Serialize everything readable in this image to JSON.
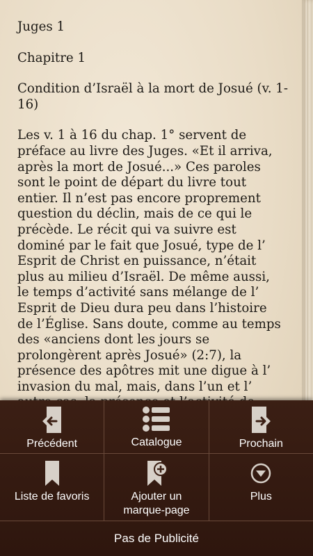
{
  "reader": {
    "book_title": "Juges 1",
    "chapter_title": "Chapitre 1",
    "section_title": "Condition d’Israël à la mort de Josué (v. 1-16)",
    "body_lines": [
      "Les v. 1 à 16 du chap. 1° servent de",
      "préface au livre des Juges. «Et il arriva,",
      "après la mort de Josué...» Ces paroles",
      "sont le point de départ du livre tout",
      "entier. Il n’est pas encore proprement",
      "question du déclin, mais de ce qui le",
      "précède. Le récit qui va suivre est",
      "dominé par le fait que Josué, type de l’",
      "Esprit de Christ en puissance, n’était",
      "plus au milieu d’Israël. De même aussi,",
      "le temps d’activité sans mélange de l’",
      "Esprit de Dieu dura peu dans l’histoire",
      "de l’Église. Sans doute, comme au temps",
      " des «anciens dont les jours se",
      "prolongèrent après Josué» (2:7), la",
      "présence des apôtres mit une digue à l’",
      "invasion du mal, mais, dans l’un et l’",
      "autre cas, la présence et l’activité de"
    ]
  },
  "menu": {
    "previous_label": "Précédent",
    "catalog_label": "Catalogue",
    "next_label": "Prochain",
    "favorites_label": "Liste de favoris",
    "add_bookmark_label": "Ajouter un marque-page",
    "more_label": "Plus",
    "no_ads_label": "Pas de Publicité"
  },
  "colors": {
    "menu_background": "#2e160e",
    "icon_color": "#d7d0c8",
    "page_color": "#ede2cf"
  }
}
